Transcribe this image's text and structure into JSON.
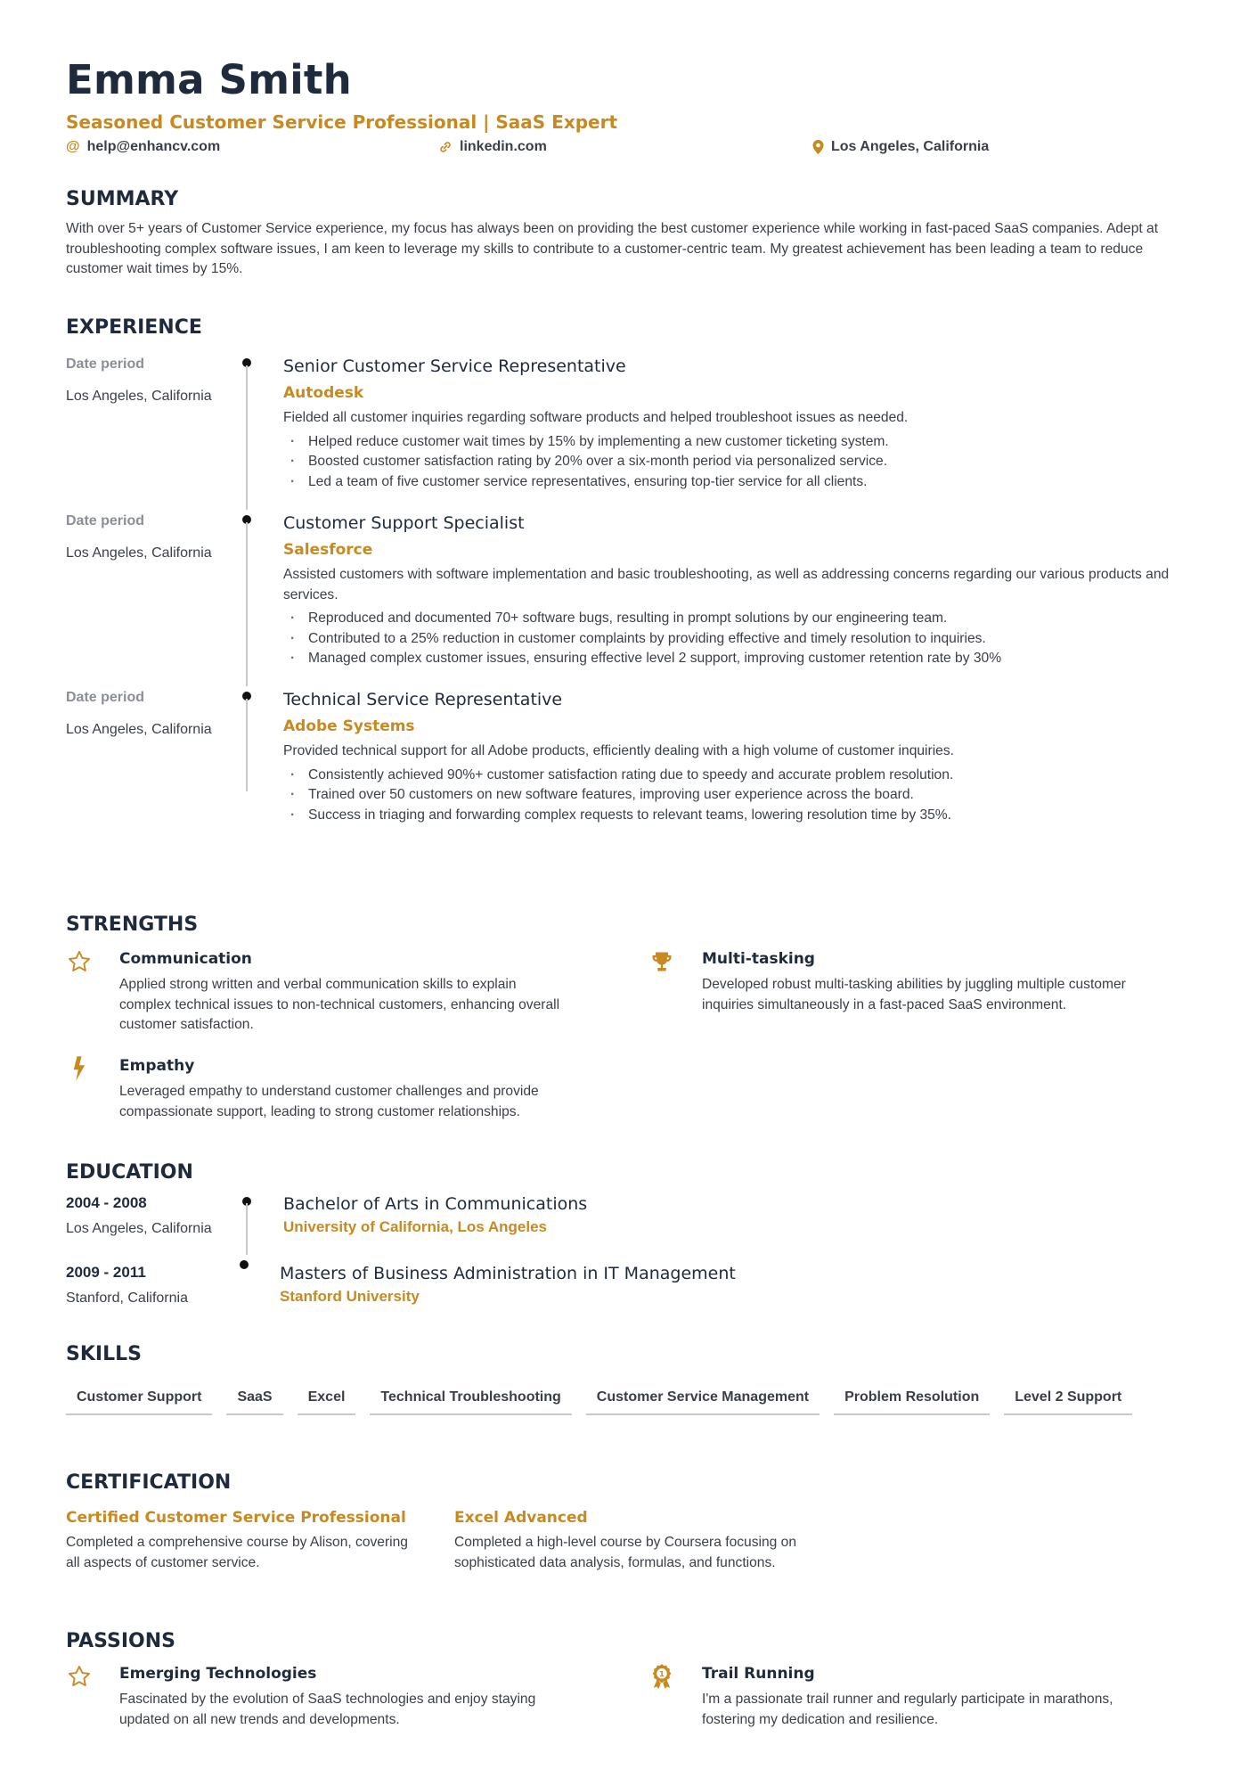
{
  "header": {
    "name": "Emma Smith",
    "headline": "Seasoned Customer Service Professional | SaaS Expert",
    "email": "help@enhancv.com",
    "linkedin": "linkedin.com",
    "location": "Los Angeles, California"
  },
  "colors": {
    "accent": "#c88a1f",
    "heading": "#1f2a3c",
    "text": "#3a3f47",
    "muted": "#8a8f96"
  },
  "summary": {
    "title": "SUMMARY",
    "text": "With over 5+ years of Customer Service experience, my focus has always been on providing the best customer experience while working in fast-paced SaaS companies. Adept at troubleshooting complex software issues, I am keen to leverage my skills to contribute to a customer-centric team. My greatest achievement has been leading a team to reduce customer wait times by 15%."
  },
  "experience": {
    "title": "EXPERIENCE",
    "items": [
      {
        "date": "Date period",
        "location": "Los Angeles, California",
        "role": "Senior Customer Service Representative",
        "company": "Autodesk",
        "description": "Fielded all customer inquiries regarding software products and helped troubleshoot issues as needed.",
        "bullets": [
          "Helped reduce customer wait times by 15% by implementing a new customer ticketing system.",
          "Boosted customer satisfaction rating by 20% over a six-month period via personalized service.",
          "Led a team of five customer service representatives, ensuring top-tier service for all clients."
        ]
      },
      {
        "date": "Date period",
        "location": "Los Angeles, California",
        "role": "Customer Support Specialist",
        "company": "Salesforce",
        "description": "Assisted customers with software implementation and basic troubleshooting, as well as addressing concerns regarding our various products and services.",
        "bullets": [
          "Reproduced and documented 70+ software bugs, resulting in prompt solutions by our engineering team.",
          "Contributed to a 25% reduction in customer complaints by providing effective and timely resolution to inquiries.",
          "Managed complex customer issues, ensuring effective level 2 support, improving customer retention rate by 30%"
        ]
      },
      {
        "date": "Date period",
        "location": "Los Angeles, California",
        "role": "Technical Service Representative",
        "company": "Adobe Systems",
        "description": "Provided technical support for all Adobe products, efficiently dealing with a high volume of customer inquiries.",
        "bullets": [
          "Consistently achieved 90%+ customer satisfaction rating due to speedy and accurate problem resolution.",
          "Trained over 50 customers on new software features, improving user experience across the board.",
          "Success in triaging and forwarding complex requests to relevant teams, lowering resolution time by 35%."
        ]
      }
    ]
  },
  "strengths": {
    "title": "STRENGTHS",
    "items": [
      {
        "icon": "star-icon",
        "title": "Communication",
        "description": "Applied strong written and verbal communication skills to explain complex technical issues to non-technical customers, enhancing overall customer satisfaction."
      },
      {
        "icon": "trophy-icon",
        "title": "Multi-tasking",
        "description": "Developed robust multi-tasking abilities by juggling multiple customer inquiries simultaneously in a fast-paced SaaS environment."
      },
      {
        "icon": "lightning-icon",
        "title": "Empathy",
        "description": "Leveraged empathy to understand customer challenges and provide compassionate support, leading to strong customer relationships."
      }
    ]
  },
  "education": {
    "title": "EDUCATION",
    "items": [
      {
        "dates": "2004 - 2008",
        "location": "Los Angeles, California",
        "degree": "Bachelor of Arts in Communications",
        "school": "University of California, Los Angeles"
      },
      {
        "dates": "2009 - 2011",
        "location": "Stanford, California",
        "degree": "Masters of Business Administration in IT Management",
        "school": "Stanford University"
      }
    ]
  },
  "skills": {
    "title": "SKILLS",
    "items": [
      "Customer Support",
      "SaaS",
      "Excel",
      "Technical Troubleshooting",
      "Customer Service Management",
      "Problem Resolution",
      "Level 2 Support"
    ]
  },
  "certification": {
    "title": "CERTIFICATION",
    "items": [
      {
        "title": "Certified Customer Service Professional",
        "description": "Completed a comprehensive course by Alison, covering all aspects of customer service."
      },
      {
        "title": "Excel Advanced",
        "description": "Completed a high-level course by Coursera focusing on sophisticated data analysis, formulas, and functions."
      }
    ]
  },
  "passions": {
    "title": "PASSIONS",
    "items": [
      {
        "icon": "star-icon",
        "title": "Emerging Technologies",
        "description": "Fascinated by the evolution of SaaS technologies and enjoy staying updated on all new trends and developments."
      },
      {
        "icon": "medal-icon",
        "title": "Trail Running",
        "description": "I'm a passionate trail runner and regularly participate in marathons, fostering my dedication and resilience."
      }
    ]
  }
}
